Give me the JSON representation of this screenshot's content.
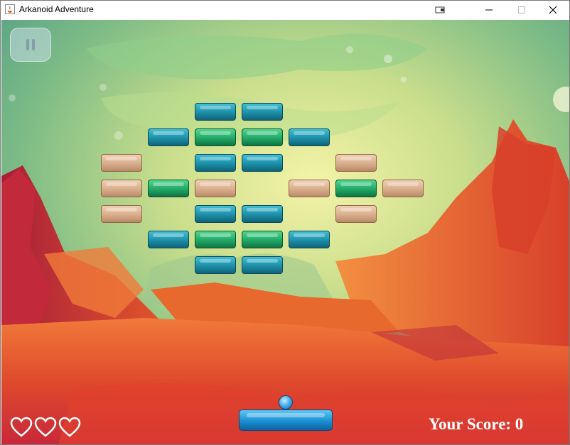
{
  "window": {
    "title": "Arkanoid Adventure",
    "buttons": [
      "restore-down",
      "minimize",
      "maximize",
      "close"
    ]
  },
  "hud": {
    "pause_icon": "pause-icon",
    "lives": 3,
    "score_label": "Your Score: 0",
    "score": 0
  },
  "bricks": [
    [
      "",
      "",
      "blue",
      "blue",
      "",
      "",
      ""
    ],
    [
      "",
      "blue",
      "green",
      "green",
      "blue",
      "",
      ""
    ],
    [
      "tan",
      "",
      "blue",
      "blue",
      "",
      "tan",
      ""
    ],
    [
      "tan",
      "green",
      "tan",
      "",
      "tan",
      "green",
      "tan"
    ],
    [
      "tan",
      "",
      "blue",
      "blue",
      "",
      "tan",
      ""
    ],
    [
      "",
      "blue",
      "green",
      "green",
      "blue",
      "",
      ""
    ],
    [
      "",
      "",
      "blue",
      "blue",
      "",
      "",
      ""
    ]
  ],
  "colors": {
    "blue_brick": "#1c8fa8",
    "green_brick": "#22a866",
    "tan_brick": "#d9ad8c",
    "paddle": "#1a8fd0",
    "score_text": "#ffffff"
  }
}
